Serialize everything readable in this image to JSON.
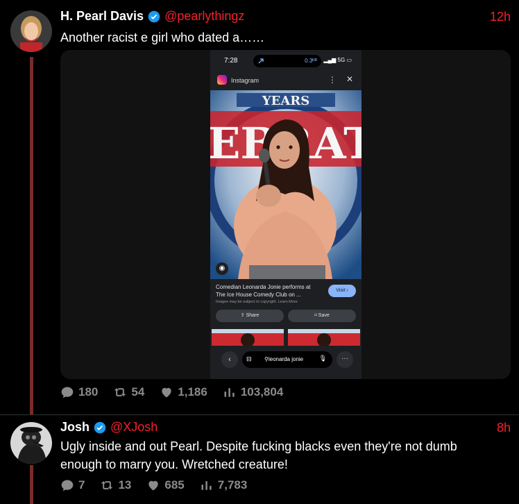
{
  "tweets": [
    {
      "name": "H. Pearl Davis",
      "handle": "@pearlythingz",
      "time": "12h",
      "text": "Another racist e girl who dated a……",
      "replies": "180",
      "retweets": "54",
      "likes": "1,186",
      "views": "103,804"
    },
    {
      "name": "Josh",
      "handle": "@XJosh",
      "time": "8h",
      "text": "Ugly inside and out Pearl. Despite fucking blacks even they're not dumb enough to marry you. Wretched creature!",
      "replies": "7",
      "retweets": "13",
      "likes": "685",
      "views": "7,783"
    }
  ],
  "phone": {
    "time": "7:28",
    "speed": "0.3ᴷᴮ",
    "signal": "5G",
    "app_label": "Instagram",
    "caption": "Comedian Leonarda Jonie performs at The Ice House Comedy Club on ...",
    "disclaimer": "Images may be subject to copyright. Learn More",
    "visit_label": "Visit",
    "share_label": "Share",
    "save_label": "Save",
    "search_query": "leonarda jonie",
    "banner_text": "YEARS"
  },
  "colors": {
    "accent": "#f4212e",
    "verified": "#1d9bf0",
    "thread": "#7a2a2a"
  }
}
